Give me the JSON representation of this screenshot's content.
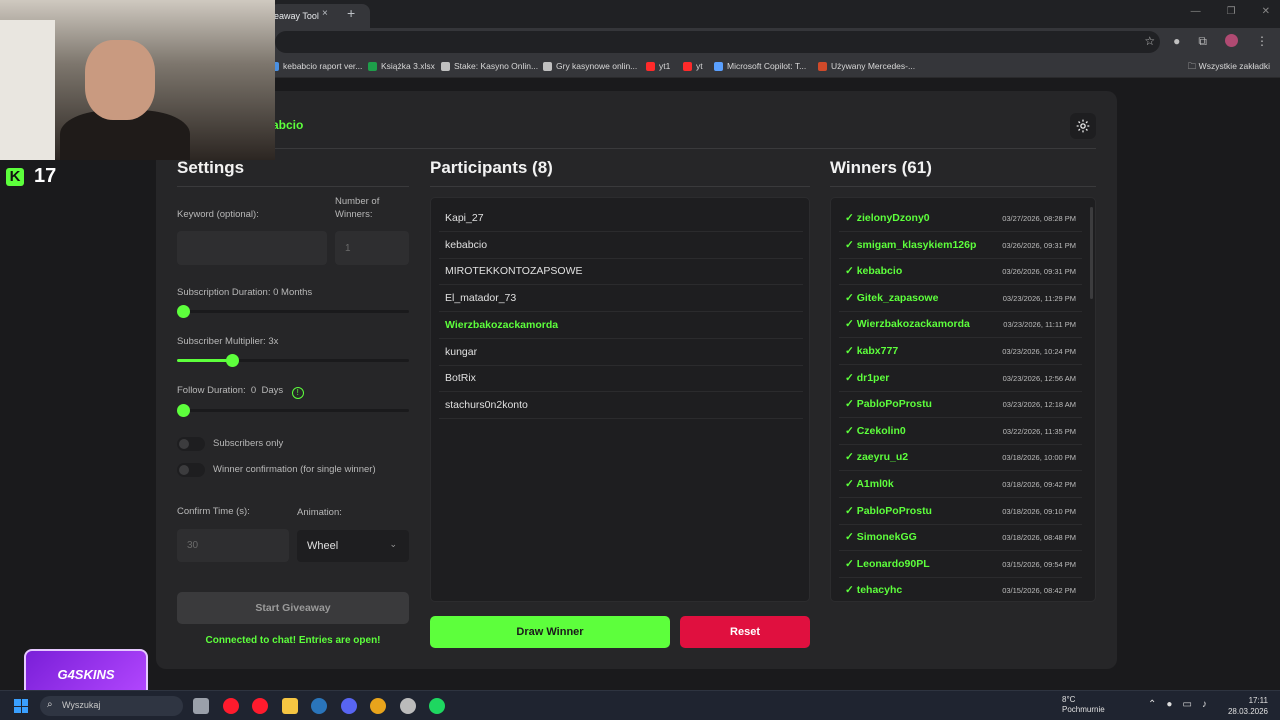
{
  "browser": {
    "tab_title": "eaway Tool",
    "tab_close": "×",
    "new_tab": "+",
    "bookmarks": [
      {
        "label": "kebabcio raport ver...",
        "color": "#4a90e2"
      },
      {
        "label": "Książka 3.xlsx",
        "color": "#1e9e4a"
      },
      {
        "label": "Stake: Kasyno Onlin...",
        "color": "#c0c0c0"
      },
      {
        "label": "Gry kasynowe onlin...",
        "color": "#c0c0c0"
      },
      {
        "label": "yt1",
        "color": "#ff2a2a"
      },
      {
        "label": "yt",
        "color": "#ff2a2a"
      },
      {
        "label": "Microsoft Copilot: T...",
        "color": "#5aa0ff"
      },
      {
        "label": "Używany Mercedes-...",
        "color": "#d04a2a"
      }
    ],
    "all_bookmarks": "Wszystkie zakładki"
  },
  "app": {
    "brand": "abcio",
    "accent_color": "#5dff3c",
    "danger_color": "#e0103f"
  },
  "settings": {
    "title": "Settings",
    "keyword_label": "Keyword (optional):",
    "keyword_value": "",
    "num_winners_label_1": "Number of",
    "num_winners_label_2": "Winners:",
    "num_winners_value": "1",
    "sub_duration_label": "Subscription Duration: 0 Months",
    "sub_duration_value": 0,
    "sub_multiplier_label": "Subscriber Multiplier: 3x",
    "sub_multiplier_fraction": 0.24,
    "follow_label_1": "Follow Duration:",
    "follow_label_2": "0",
    "follow_label_3": "Days",
    "follow_info": "!",
    "follow_duration_value": 0,
    "subscribers_only": "Subscribers only",
    "winner_confirm": "Winner confirmation (for single winner)",
    "confirm_time_label": "Confirm Time (s):",
    "confirm_time_value": "30",
    "animation_label": "Animation:",
    "animation_value": "Wheel",
    "start_button": "Start Giveaway",
    "status": "Connected to chat! Entries are open!"
  },
  "participants": {
    "title": "Participants (8)",
    "items": [
      {
        "name": "Kapi_27",
        "highlight": false
      },
      {
        "name": "kebabcio",
        "highlight": false
      },
      {
        "name": "MIROTEKKONTOZAPSOWE",
        "highlight": false
      },
      {
        "name": "El_matador_73",
        "highlight": false
      },
      {
        "name": "Wierzbakozackamorda",
        "highlight": true
      },
      {
        "name": "kungar",
        "highlight": false
      },
      {
        "name": "BotRix",
        "highlight": false
      },
      {
        "name": "stachurs0n2konto",
        "highlight": false
      }
    ]
  },
  "winners": {
    "title": "Winners (61)",
    "items": [
      {
        "name": "✓ zielonyDzony0",
        "date": "03/27/2026, 08:28 PM"
      },
      {
        "name": "✓ smigam_klasykiem126p",
        "date": "03/26/2026, 09:31 PM"
      },
      {
        "name": "✓ kebabcio",
        "date": "03/26/2026, 09:31 PM"
      },
      {
        "name": "✓ Gitek_zapasowe",
        "date": "03/23/2026, 11:29 PM"
      },
      {
        "name": "✓ Wierzbakozackamorda",
        "date": "03/23/2026, 11:11 PM"
      },
      {
        "name": "✓ kabx777",
        "date": "03/23/2026, 10:24 PM"
      },
      {
        "name": "✓ dr1per",
        "date": "03/23/2026, 12:56 AM"
      },
      {
        "name": "✓ PabloPoProstu",
        "date": "03/23/2026, 12:18 AM"
      },
      {
        "name": "✓ Czekolin0",
        "date": "03/22/2026, 11:35 PM"
      },
      {
        "name": "✓ zaeyru_u2",
        "date": "03/18/2026, 10:00 PM"
      },
      {
        "name": "✓ A1ml0k",
        "date": "03/18/2026, 09:42 PM"
      },
      {
        "name": "✓ PabloPoProstu",
        "date": "03/18/2026, 09:10 PM"
      },
      {
        "name": "✓ SimonekGG",
        "date": "03/18/2026, 08:48 PM"
      },
      {
        "name": "✓ Leonardo90PL",
        "date": "03/15/2026, 09:54 PM"
      },
      {
        "name": "✓ tehacyhc",
        "date": "03/15/2026, 08:42 PM"
      }
    ]
  },
  "actions": {
    "draw": "Draw Winner",
    "reset": "Reset"
  },
  "overlay": {
    "kick_logo": "K",
    "kick_viewers": "17",
    "sponsor": "G4SKINS"
  },
  "taskbar": {
    "search_placeholder": "Wyszukaj",
    "weather_temp": "8°C",
    "weather_desc": "Pochmurnie",
    "time": "17:11",
    "date": "28.03.2026",
    "apps": [
      {
        "name": "task-view",
        "color": "#9aa0aa"
      },
      {
        "name": "opera",
        "color": "#ff1b2d"
      },
      {
        "name": "opera-gx",
        "color": "#ff1b2d"
      },
      {
        "name": "file-explorer",
        "color": "#f5c542"
      },
      {
        "name": "steam",
        "color": "#2a75bb"
      },
      {
        "name": "discord",
        "color": "#5865f2"
      },
      {
        "name": "chrome",
        "color": "#e8a41c"
      },
      {
        "name": "app-x",
        "color": "#bbbbbb"
      },
      {
        "name": "spotify",
        "color": "#1ed760"
      }
    ]
  }
}
